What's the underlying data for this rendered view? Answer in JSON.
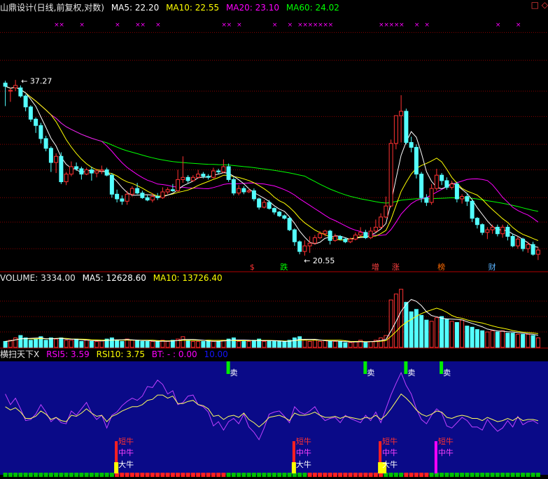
{
  "header_main": {
    "title": "山鼎设计(日线,前复权,对数)",
    "ma5": "MA5: 22.20",
    "ma10": "MA10: 22.55",
    "ma20": "MA20: 23.10",
    "ma60": "MA60: 24.02",
    "corner_icons": "□ ◇"
  },
  "header_volume": {
    "volume": "VOLUME: 3334.00",
    "ma5": "MA5: 12628.60",
    "ma10": "MA10: 13726.40"
  },
  "header_indicator": {
    "name": "横扫天下X",
    "rsi5": "RSI5: 3.59",
    "rsi10": "RSI10: 3.75",
    "bt": "BT: - : 0.00",
    "extra": "10.00"
  },
  "colors": {
    "up": "#ff3232",
    "down": "#54ffff",
    "ma5": "#ffffff",
    "ma10": "#ffff00",
    "ma20": "#ff00ff",
    "ma60": "#00ff00",
    "indicator_bg": "#0a0a88",
    "grid": "#8b0000"
  },
  "chart_data": {
    "type": "candlestick",
    "price_scale": "log",
    "price_range": [
      19.5,
      48.0
    ],
    "high_label": "37.27",
    "low_label": "20.55",
    "ohlc": [
      [
        37.0,
        36.6,
        37.3,
        34.2
      ],
      [
        36.0,
        36.1,
        36.4,
        34.7
      ],
      [
        36.4,
        36.7,
        37.4,
        36.0
      ],
      [
        36.4,
        35.4,
        36.7,
        35.2
      ],
      [
        35.4,
        34.1,
        35.6,
        33.6
      ],
      [
        34.1,
        32.7,
        34.3,
        32.4
      ],
      [
        32.7,
        32.0,
        32.9,
        31.2
      ],
      [
        32.0,
        30.6,
        32.3,
        30.1
      ],
      [
        30.6,
        29.6,
        30.9,
        29.3
      ],
      [
        29.6,
        28.2,
        29.8,
        27.3
      ],
      [
        28.2,
        28.8,
        29.1,
        27.2
      ],
      [
        28.8,
        26.4,
        29.2,
        26.2
      ],
      [
        26.4,
        27.1,
        27.3,
        26.1
      ],
      [
        27.1,
        27.8,
        28.3,
        26.9
      ],
      [
        27.8,
        27.6,
        28.2,
        27.4
      ],
      [
        27.6,
        27.1,
        27.8,
        26.6
      ],
      [
        27.1,
        27.5,
        27.7,
        27.0
      ],
      [
        27.5,
        27.2,
        27.8,
        26.5
      ],
      [
        27.2,
        27.4,
        27.6,
        26.8
      ],
      [
        27.4,
        27.5,
        27.9,
        27.1
      ],
      [
        27.5,
        27.0,
        27.7,
        26.9
      ],
      [
        27.0,
        25.3,
        27.2,
        25.0
      ],
      [
        25.3,
        24.9,
        25.7,
        24.6
      ],
      [
        24.9,
        24.7,
        25.2,
        24.4
      ],
      [
        24.7,
        25.3,
        25.6,
        24.4
      ],
      [
        25.3,
        25.8,
        26.0,
        25.1
      ],
      [
        25.8,
        25.4,
        26.3,
        25.3
      ],
      [
        25.4,
        25.0,
        25.6,
        24.9
      ],
      [
        25.0,
        24.8,
        25.2,
        24.7
      ],
      [
        24.8,
        25.1,
        25.4,
        24.6
      ],
      [
        25.1,
        25.0,
        25.4,
        24.8
      ],
      [
        25.0,
        25.5,
        25.9,
        24.9
      ],
      [
        25.5,
        25.7,
        25.9,
        25.3
      ],
      [
        25.7,
        25.6,
        26.2,
        25.5
      ],
      [
        25.6,
        26.6,
        27.5,
        25.5
      ],
      [
        26.6,
        26.8,
        28.8,
        26.3
      ],
      [
        26.8,
        26.5,
        27.0,
        26.3
      ],
      [
        26.5,
        26.8,
        27.0,
        26.4
      ],
      [
        26.8,
        27.1,
        27.5,
        26.7
      ],
      [
        27.1,
        26.9,
        27.3,
        26.7
      ],
      [
        26.9,
        26.8,
        27.1,
        26.6
      ],
      [
        26.8,
        27.4,
        27.7,
        26.7
      ],
      [
        27.4,
        27.3,
        27.6,
        27.1
      ],
      [
        27.3,
        27.8,
        28.5,
        27.2
      ],
      [
        27.8,
        26.6,
        28.1,
        26.4
      ],
      [
        26.6,
        25.4,
        26.8,
        25.2
      ],
      [
        25.4,
        25.8,
        26.1,
        25.2
      ],
      [
        25.8,
        25.5,
        26.0,
        25.3
      ],
      [
        25.5,
        25.6,
        25.8,
        25.4
      ],
      [
        25.6,
        24.9,
        25.8,
        24.7
      ],
      [
        24.9,
        24.2,
        25.0,
        24.0
      ],
      [
        24.2,
        24.6,
        24.8,
        24.1
      ],
      [
        24.6,
        24.1,
        24.8,
        24.0
      ],
      [
        24.1,
        23.8,
        24.2,
        23.6
      ],
      [
        23.8,
        23.5,
        23.9,
        23.4
      ],
      [
        23.5,
        23.3,
        23.6,
        23.2
      ],
      [
        23.3,
        22.4,
        23.4,
        22.3
      ],
      [
        22.4,
        21.5,
        22.5,
        21.2
      ],
      [
        21.5,
        20.8,
        21.6,
        20.6
      ],
      [
        20.8,
        21.2,
        21.6,
        20.5
      ],
      [
        21.2,
        21.4,
        21.9,
        20.7
      ],
      [
        21.4,
        21.8,
        22.0,
        21.3
      ],
      [
        21.8,
        22.1,
        22.3,
        21.7
      ],
      [
        22.1,
        22.3,
        22.4,
        21.9
      ],
      [
        22.3,
        21.6,
        22.4,
        21.3
      ],
      [
        21.6,
        21.9,
        22.1,
        21.5
      ],
      [
        21.9,
        21.7,
        22.0,
        21.6
      ],
      [
        21.7,
        21.5,
        21.8,
        21.4
      ],
      [
        21.5,
        21.7,
        21.8,
        21.4
      ],
      [
        21.7,
        22.0,
        22.2,
        21.6
      ],
      [
        22.0,
        22.2,
        22.6,
        21.9
      ],
      [
        22.2,
        21.8,
        22.4,
        21.7
      ],
      [
        21.8,
        22.3,
        22.6,
        21.7
      ],
      [
        22.3,
        22.6,
        23.2,
        22.2
      ],
      [
        22.6,
        23.4,
        23.7,
        22.5
      ],
      [
        23.4,
        24.3,
        25.1,
        23.3
      ],
      [
        24.3,
        30.1,
        30.5,
        24.2
      ],
      [
        30.1,
        33.1,
        33.1,
        29.5
      ],
      [
        33.1,
        33.6,
        35.5,
        30.2
      ],
      [
        33.6,
        30.2,
        33.9,
        30.0
      ],
      [
        30.2,
        29.7,
        30.8,
        29.2
      ],
      [
        29.7,
        27.1,
        30.0,
        26.7
      ],
      [
        27.1,
        25.0,
        27.3,
        24.6
      ],
      [
        25.0,
        24.6,
        25.3,
        24.3
      ],
      [
        24.6,
        25.8,
        26.2,
        24.4
      ],
      [
        25.8,
        27.0,
        27.6,
        25.6
      ],
      [
        27.0,
        26.5,
        27.2,
        26.1
      ],
      [
        26.5,
        25.9,
        26.8,
        25.7
      ],
      [
        25.9,
        26.2,
        26.5,
        25.7
      ],
      [
        26.2,
        24.9,
        26.4,
        24.6
      ],
      [
        24.9,
        25.1,
        25.3,
        24.5
      ],
      [
        25.1,
        24.7,
        25.4,
        24.3
      ],
      [
        24.7,
        23.3,
        24.8,
        23.0
      ],
      [
        23.3,
        22.8,
        23.4,
        22.5
      ],
      [
        22.8,
        22.2,
        22.9,
        22.0
      ],
      [
        22.2,
        22.4,
        22.6,
        21.7
      ],
      [
        22.4,
        22.6,
        22.8,
        22.1
      ],
      [
        22.6,
        22.1,
        22.8,
        21.9
      ],
      [
        22.1,
        22.6,
        22.8,
        21.8
      ],
      [
        22.6,
        21.9,
        22.8,
        21.6
      ],
      [
        21.9,
        21.2,
        22.1,
        21.1
      ],
      [
        21.2,
        21.7,
        21.9,
        21.0
      ],
      [
        21.7,
        21.0,
        21.8,
        20.8
      ],
      [
        21.0,
        21.3,
        21.5,
        20.7
      ],
      [
        21.3,
        20.6,
        21.5,
        20.5
      ],
      [
        20.6,
        20.9,
        21.1,
        20.2
      ]
    ],
    "volume": [
      5,
      6,
      8,
      10,
      8,
      6,
      7,
      9,
      6,
      8,
      7,
      8,
      6,
      6,
      7,
      5,
      6,
      5,
      5,
      6,
      7,
      8,
      6,
      5,
      7,
      6,
      6,
      5,
      5,
      5,
      5,
      6,
      5,
      6,
      7,
      9,
      6,
      5,
      5,
      5,
      6,
      5,
      5,
      6,
      7,
      8,
      5,
      5,
      5,
      6,
      7,
      5,
      5,
      5,
      5,
      5,
      6,
      8,
      9,
      6,
      5,
      6,
      5,
      6,
      5,
      5,
      5,
      4,
      4,
      5,
      6,
      4,
      5,
      6,
      8,
      10,
      40,
      45,
      49,
      38,
      30,
      32,
      27,
      23,
      22,
      25,
      26,
      24,
      22,
      21,
      23,
      18,
      17,
      15,
      14,
      13,
      14,
      13,
      14,
      12,
      12,
      11,
      11,
      11,
      10,
      8
    ],
    "volume_scale_max": 52,
    "rsi5": [
      72,
      62,
      68,
      58,
      47,
      48,
      53,
      62,
      55,
      46,
      50,
      45,
      44,
      56,
      52,
      58,
      64,
      54,
      48,
      52,
      40,
      52,
      55,
      61,
      65,
      68,
      66,
      70,
      79,
      78,
      85,
      81,
      72,
      75,
      62,
      64,
      70,
      71,
      62,
      60,
      55,
      42,
      46,
      38,
      46,
      49,
      44,
      53,
      41,
      36,
      29,
      40,
      53,
      55,
      56,
      51,
      45,
      60,
      55,
      53,
      56,
      60,
      52,
      47,
      49,
      50,
      45,
      52,
      49,
      47,
      45,
      52,
      47,
      55,
      45,
      58,
      71,
      82,
      92,
      80,
      72,
      58,
      48,
      44,
      52,
      58,
      54,
      42,
      40,
      45,
      50,
      47,
      41,
      41,
      38,
      48,
      42,
      37,
      40,
      47,
      41,
      51,
      43,
      46,
      47,
      44
    ],
    "rsi10": [
      60,
      57,
      59,
      55,
      49,
      49,
      51,
      56,
      53,
      48,
      50,
      47,
      46,
      52,
      51,
      54,
      58,
      54,
      51,
      52,
      46,
      51,
      53,
      56,
      58,
      60,
      60,
      62,
      66,
      67,
      71,
      71,
      68,
      70,
      63,
      63,
      65,
      66,
      62,
      61,
      58,
      51,
      52,
      48,
      51,
      52,
      50,
      54,
      48,
      45,
      41,
      45,
      50,
      51,
      52,
      50,
      47,
      54,
      52,
      52,
      53,
      55,
      52,
      50,
      50,
      51,
      49,
      51,
      50,
      49,
      48,
      50,
      49,
      52,
      48,
      52,
      58,
      65,
      72,
      68,
      63,
      57,
      53,
      51,
      53,
      56,
      55,
      50,
      49,
      51,
      52,
      51,
      49,
      49,
      47,
      50,
      48,
      46,
      47,
      49,
      47,
      50,
      47,
      48,
      48,
      47
    ],
    "sell_signals": [
      "卖",
      "卖",
      "卖",
      "卖"
    ],
    "event_labels": [
      "$",
      "跌",
      "增",
      "涨",
      "榜",
      "财"
    ],
    "signal_labels": {
      "short_bull": "短牛",
      "mid_bull": "中牛",
      "big_bull": "大牛"
    }
  }
}
